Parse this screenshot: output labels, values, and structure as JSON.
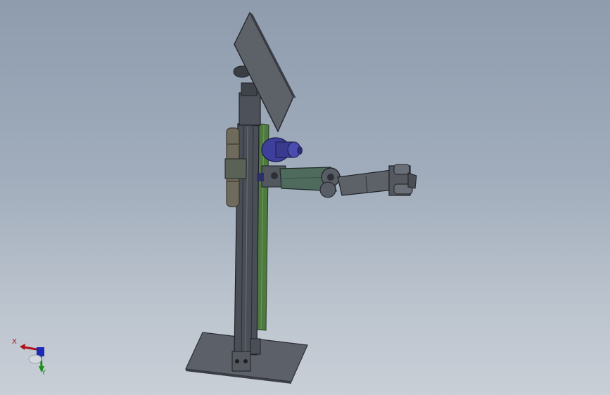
{
  "scene": {
    "background_top": "#8e9cae",
    "background_bottom": "#c9cfd7"
  },
  "triad": {
    "x_label": "X",
    "y_label": "Y",
    "x_color": "#b0121b",
    "y_color": "#1a8f1a",
    "z_color": "#1b2bb5"
  }
}
